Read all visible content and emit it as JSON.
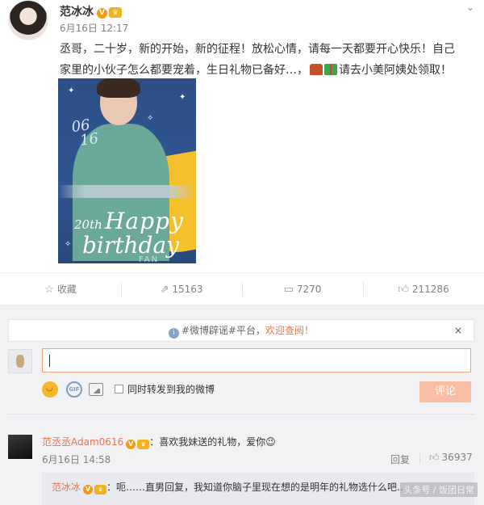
{
  "post": {
    "author": "范冰冰",
    "v_badge": "V",
    "crown_badge": "♛",
    "time": "6月16日 12:17",
    "text_line1": "丞哥，二十岁，新的开始，新的征程！放松心情，请每一天都要开心快乐！自己",
    "text_line2a": "家里的小伙子怎么都要宠着，生日礼物已备好…，",
    "text_line2b": "请去小美阿姨处领取！",
    "dropdown": "⌄",
    "image": {
      "date_text_1": "06",
      "date_text_2": "16",
      "ordinal": "20th",
      "happy": "Happy",
      "birthday": "birthday",
      "fan": "FAN"
    }
  },
  "actions": {
    "favorite_label": "收藏",
    "repost_count": "15163",
    "comment_count": "7270",
    "like_count": "211286"
  },
  "comment_panel": {
    "notice_prefix": "#微博辟谣#平台，",
    "notice_accent": "欢迎查阅！",
    "notice_close": "×",
    "input_value": "",
    "gif_label": "GIF",
    "repost_option": "同时转发到我的微博",
    "submit_label": "评论"
  },
  "comments": [
    {
      "user": "范丞丞Adam0616",
      "v_badge": "V",
      "crown_badge": "♛",
      "text": "：喜欢我妹送的礼物，爱你😉",
      "time": "6月16日 14:58",
      "reply_label": "回复",
      "like_count": "36937",
      "reply": {
        "user": "范冰冰",
        "v_badge": "V",
        "crown_badge": "♛",
        "text": "：呃……直男回复，我知道你脑子里现在想的是明年的礼物选什么吧……"
      }
    }
  ],
  "watermark": "头条号 / 饭团日常"
}
